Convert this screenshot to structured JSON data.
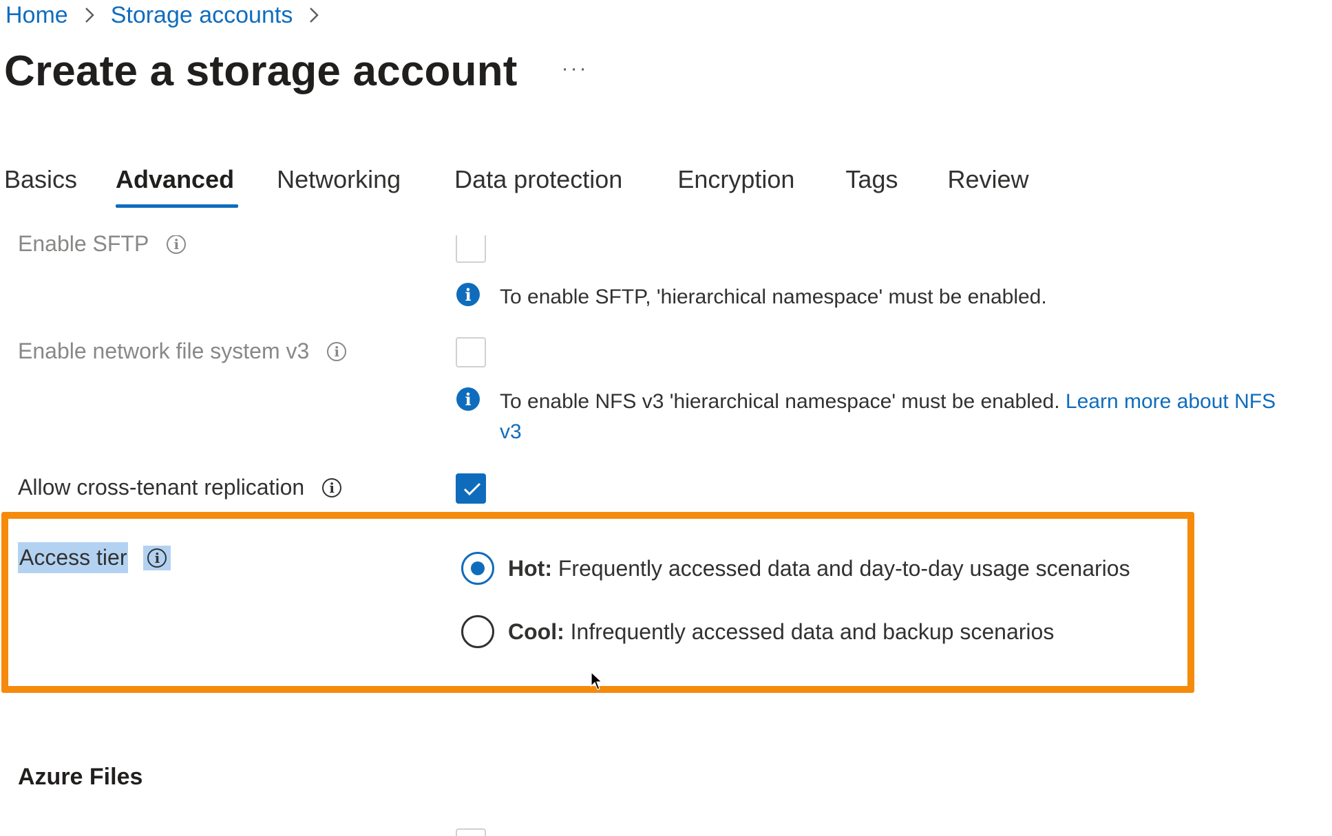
{
  "breadcrumb": {
    "items": [
      "Home",
      "Storage accounts"
    ],
    "separator_icon": "chevron-right-icon"
  },
  "page": {
    "title": "Create a storage account",
    "more_label": "···"
  },
  "tabs": [
    {
      "label": "Basics",
      "active": false
    },
    {
      "label": "Advanced",
      "active": true
    },
    {
      "label": "Networking",
      "active": false
    },
    {
      "label": "Data protection",
      "active": false
    },
    {
      "label": "Encryption",
      "active": false
    },
    {
      "label": "Tags",
      "active": false
    },
    {
      "label": "Review",
      "active": false
    }
  ],
  "settings": {
    "sftp": {
      "label": "Enable SFTP",
      "checked": false,
      "disabled": true,
      "note": "To enable SFTP, 'hierarchical namespace' must be enabled."
    },
    "nfs": {
      "label": "Enable network file system v3",
      "checked": false,
      "disabled": true,
      "note": "To enable NFS v3 'hierarchical namespace' must be enabled.",
      "link_text": "Learn more about NFS v3"
    },
    "cross_tenant": {
      "label": "Allow cross-tenant replication",
      "checked": true
    },
    "access_tier": {
      "label": "Access tier",
      "options": [
        {
          "name": "Hot:",
          "description": "Frequently accessed data and day-to-day usage scenarios",
          "selected": true
        },
        {
          "name": "Cool:",
          "description": "Infrequently accessed data and backup scenarios",
          "selected": false
        }
      ]
    }
  },
  "sections": {
    "azure_files": "Azure Files"
  },
  "colors": {
    "accent": "#0f6cbd",
    "highlight": "#f58a0b"
  }
}
